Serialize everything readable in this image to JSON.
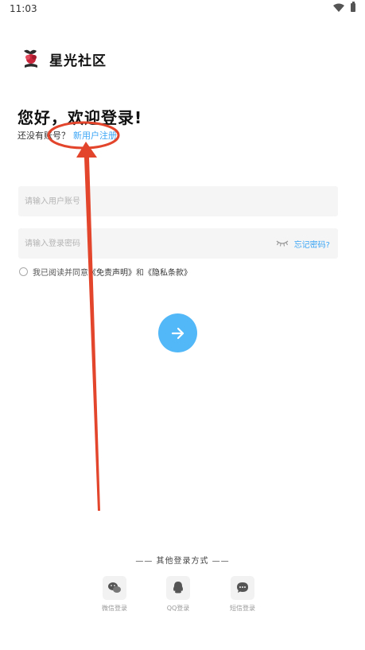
{
  "status_bar": {
    "time": "11:03"
  },
  "brand": {
    "name": "星光社区"
  },
  "welcome": {
    "title": "您好，欢迎登录!",
    "no_account_prompt": "还没有账号？",
    "register_link": "新用户注册"
  },
  "login_form": {
    "account_placeholder": "请输入用户账号",
    "password_placeholder": "请输入登录密码",
    "forgot_password": "忘记密码?"
  },
  "agreement": {
    "prefix": "我已阅读并同意",
    "disclaimer": "《免责声明》",
    "conjunction": "和",
    "privacy": "《隐私条款》"
  },
  "other_login": {
    "heading": "—— 其他登录方式 ——",
    "options": [
      {
        "label": "微信登录",
        "icon": "wechat-icon"
      },
      {
        "label": "QQ登录",
        "icon": "qq-icon"
      },
      {
        "label": "短信登录",
        "icon": "sms-icon"
      }
    ]
  },
  "colors": {
    "accent": "#3ba5f5",
    "submit": "#53b8f8",
    "annotation": "#e2452b"
  }
}
